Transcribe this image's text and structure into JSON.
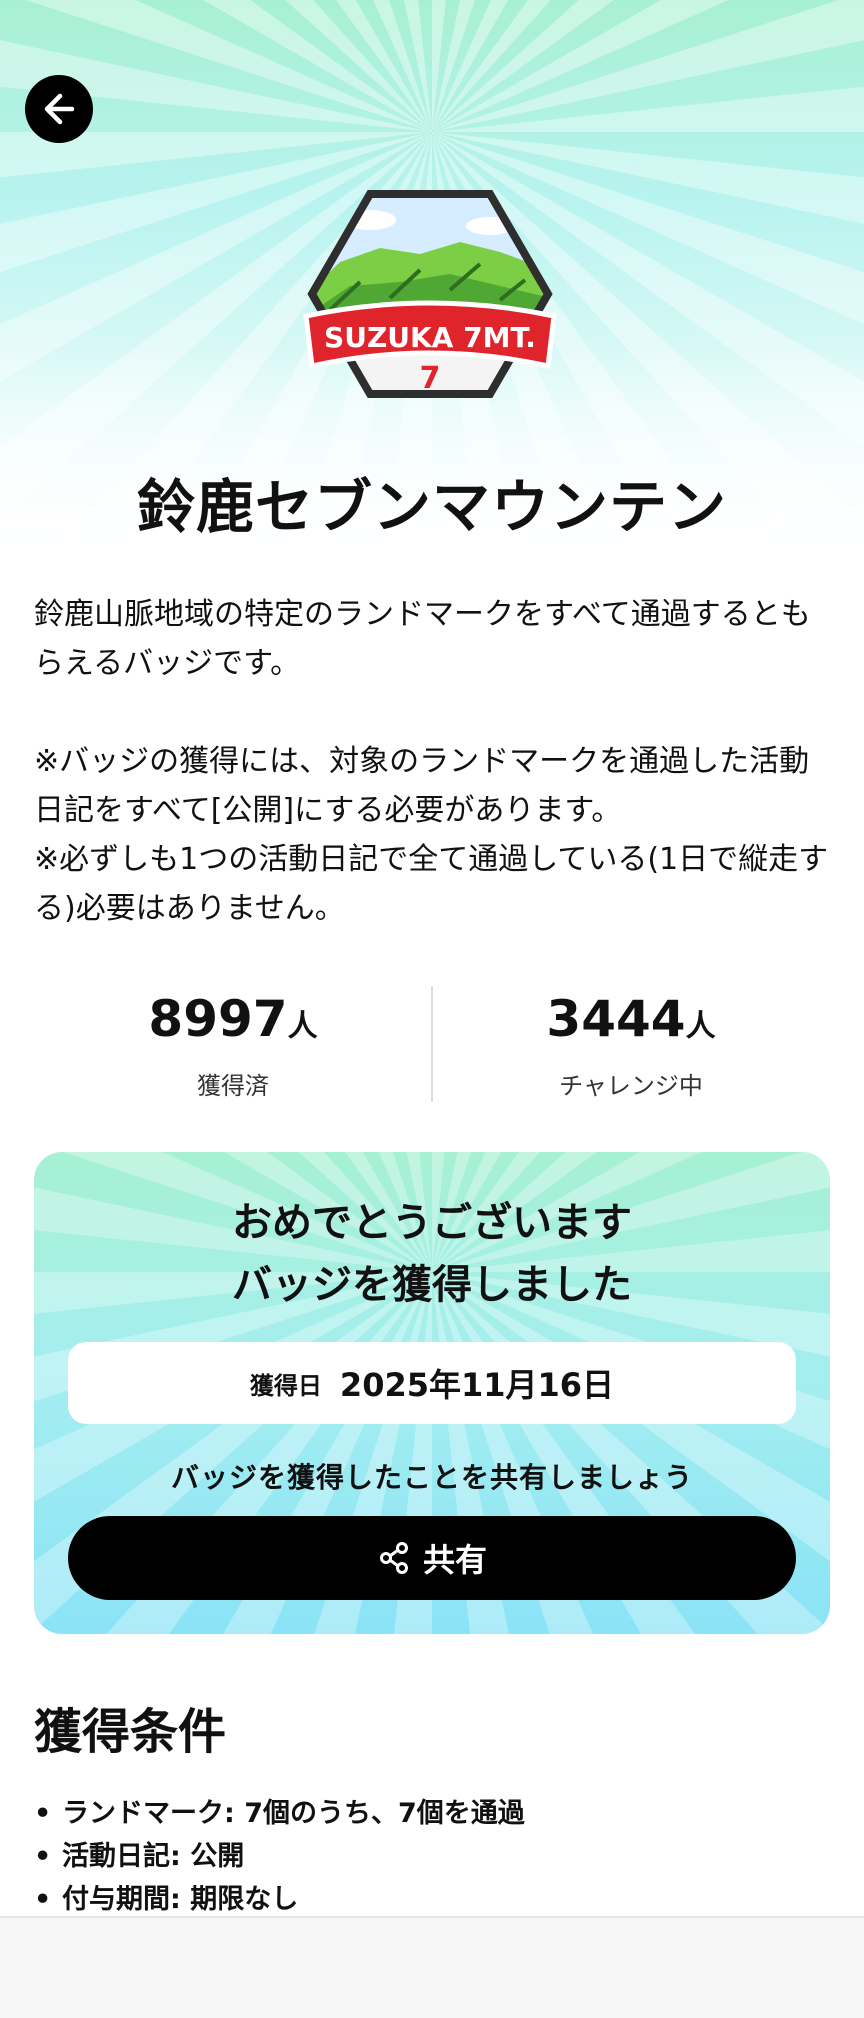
{
  "header": {
    "back_icon": "arrow-left-icon"
  },
  "badge": {
    "logo_text": "SUZUKA 7MT.",
    "logo_number": "7",
    "colors": {
      "ribbon": "#e0242b",
      "mountain": "#5fb83a",
      "sky": "#cfe8ff"
    }
  },
  "title": "鈴鹿セブンマウンテン",
  "description": {
    "line1": "鈴鹿山脈地域の特定のランドマークをすべて通過するともらえるバッジです。",
    "note1": "※バッジの獲得には、対象のランドマークを通過した活動日記をすべて[公開]にする必要があります。",
    "note2": "※必ずしも1つの活動日記で全て通過している(1日で縦走する)必要はありません。"
  },
  "stats": {
    "acquired": {
      "value": "8997",
      "unit": "人",
      "label": "獲得済"
    },
    "challenging": {
      "value": "3444",
      "unit": "人",
      "label": "チャレンジ中"
    }
  },
  "card": {
    "congrats_line1": "おめでとうございます",
    "congrats_line2": "バッジを獲得しました",
    "date_label": "獲得日",
    "date_value": "2025年11月16日",
    "share_hint": "バッジを獲得したことを共有しましょう",
    "share_label": "共有",
    "share_icon": "share-icon"
  },
  "conditions": {
    "title": "獲得条件",
    "items": [
      "ランドマーク: 7個のうち、7個を通過",
      "活動日記: 公開",
      "付与期間: 期限なし"
    ]
  }
}
